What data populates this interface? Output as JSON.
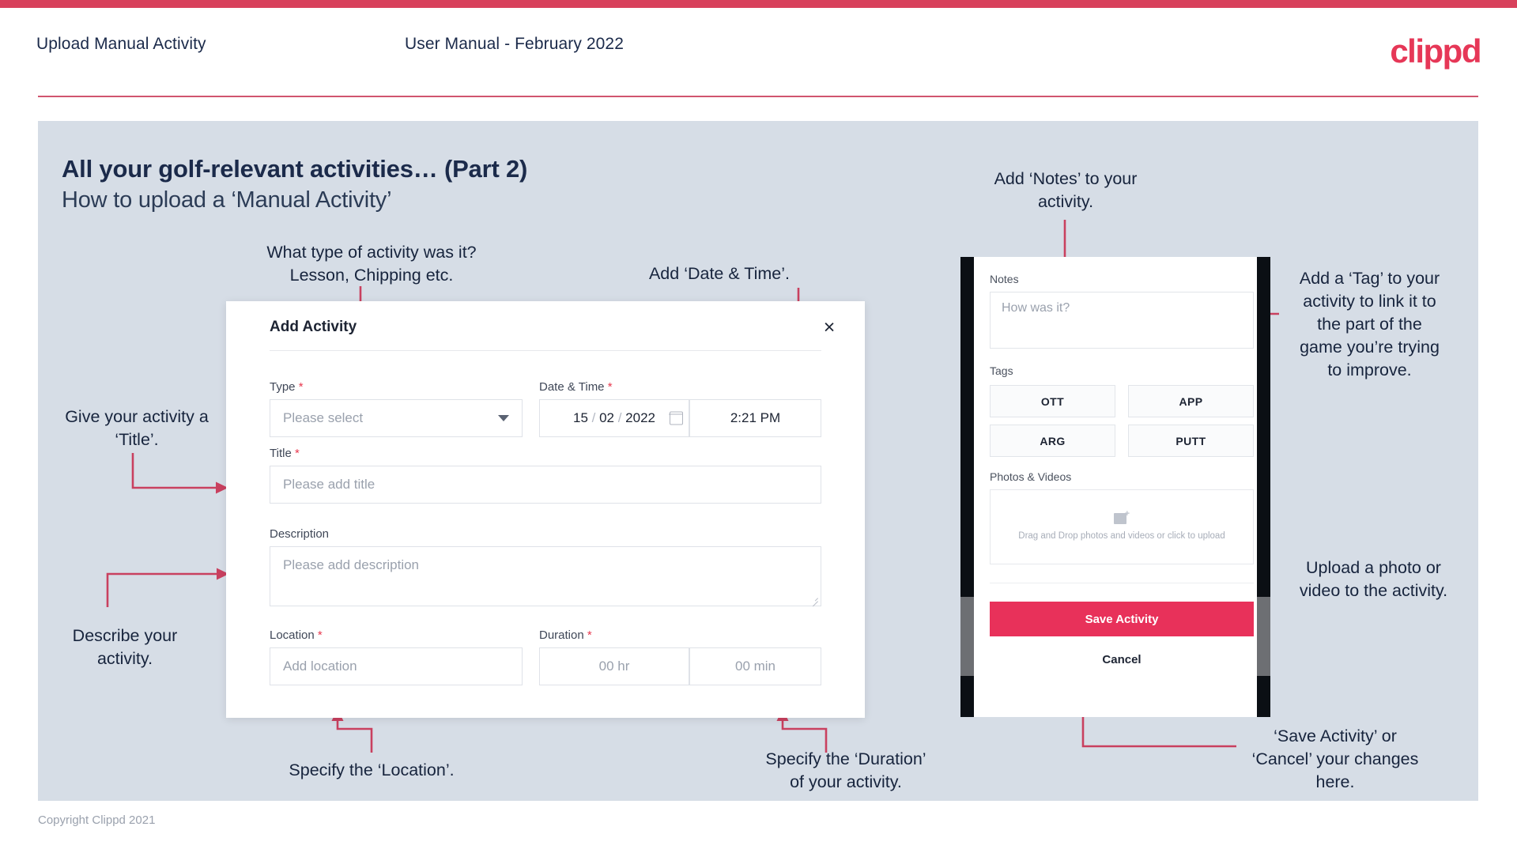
{
  "header": {
    "title": "Upload Manual Activity",
    "subtitle": "User Manual - February 2022",
    "logo": "clippd"
  },
  "slide": {
    "title": "All your golf-relevant activities… (Part 2)",
    "subtitle": "How to upload a ‘Manual Activity’"
  },
  "dialog": {
    "title": "Add Activity",
    "close_icon": "×",
    "fields": {
      "type": {
        "label": "Type",
        "required": "*",
        "placeholder": "Please select"
      },
      "datetime": {
        "label": "Date & Time",
        "required": "*",
        "day": "15",
        "month": "02",
        "year": "2022",
        "time": "2:21 PM"
      },
      "title": {
        "label": "Title",
        "required": "*",
        "placeholder": "Please add title"
      },
      "description": {
        "label": "Description",
        "required": "",
        "placeholder": "Please add description"
      },
      "location": {
        "label": "Location",
        "required": "*",
        "placeholder": "Add location"
      },
      "duration": {
        "label": "Duration",
        "required": "*",
        "hours_placeholder": "00 hr",
        "minutes_placeholder": "00 min"
      }
    }
  },
  "phone": {
    "notes_label": "Notes",
    "notes_placeholder": "How was it?",
    "tags_label": "Tags",
    "tags": [
      "OTT",
      "APP",
      "ARG",
      "PUTT"
    ],
    "photos_label": "Photos & Videos",
    "drop_text": "Drag and Drop photos and videos or\nclick to upload",
    "drop_icon": "add-image-icon",
    "save_label": "Save Activity",
    "cancel_label": "Cancel"
  },
  "annotations": {
    "type": "What type of activity was it?\nLesson, Chipping etc.",
    "datetime": "Add ‘Date & Time’.",
    "title": "Give your activity a\n‘Title’.",
    "description": "Describe your\nactivity.",
    "location": "Specify the ‘Location’.",
    "duration": "Specify the ‘Duration’\nof your activity.",
    "notes": "Add ‘Notes’ to your\nactivity.",
    "tags": "Add a ‘Tag’ to your\nactivity to link it to\nthe part of the\ngame you’re trying\nto improve.",
    "photos": "Upload a photo or\nvideo to the activity.",
    "save": "‘Save Activity’ or\n‘Cancel’ your changes\nhere."
  },
  "footer": {
    "copyright": "Copyright Clippd 2021"
  },
  "colors": {
    "brand": "#e63757",
    "accent_line": "#c9405f",
    "slide_bg": "#d6dde6",
    "text_dark": "#17243d",
    "save_button": "#e8315a"
  }
}
